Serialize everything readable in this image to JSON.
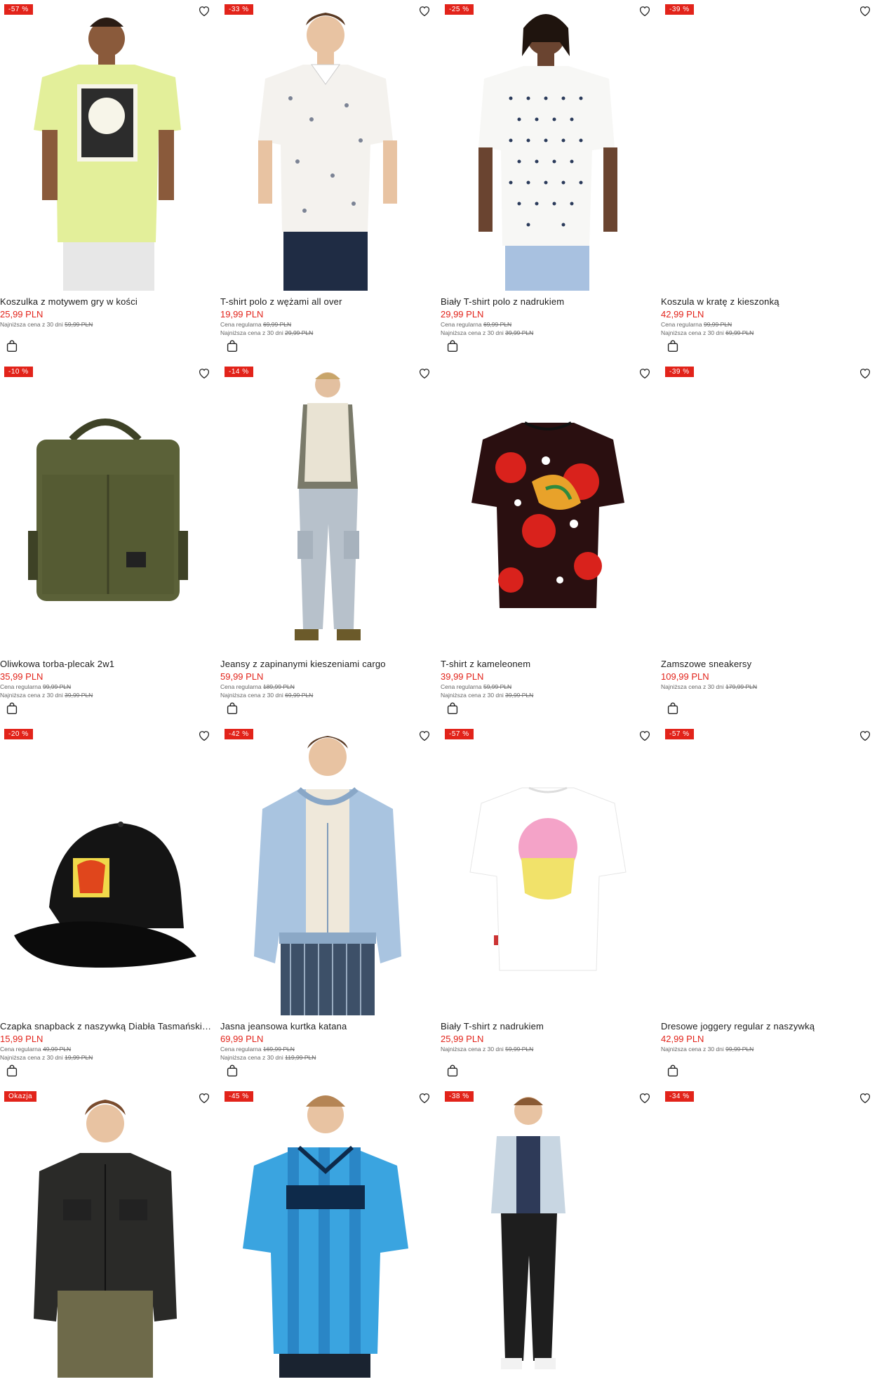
{
  "products": [
    {
      "name": "Koszulka z motywem gry w kości",
      "price": "25,99 PLN",
      "badge": "-57 %",
      "regular_label": "",
      "regular_price": "",
      "lowest_label": "Najniższa cena z 30 dni",
      "lowest_price": "59,99 PLN",
      "image": "yellow-tshirt-photo",
      "colors": {
        "main": "#e3ef9a",
        "accent": "#2c2c2c"
      }
    },
    {
      "name": "T-shirt polo z wężami all over",
      "price": "19,99 PLN",
      "badge": "-33 %",
      "regular_label": "Cena regularna",
      "regular_price": "69,99 PLN",
      "lowest_label": "Najniższa cena z 30 dni",
      "lowest_price": "29,99 PLN",
      "image": "white-polo-snakes-photo",
      "colors": {
        "main": "#f4f2ee",
        "accent": "#2b3a5a"
      }
    },
    {
      "name": "Biały T-shirt polo z nadrukiem",
      "price": "29,99 PLN",
      "badge": "-25 %",
      "regular_label": "Cena regularna",
      "regular_price": "69,99 PLN",
      "lowest_label": "Najniższa cena z 30 dni",
      "lowest_price": "39,99 PLN",
      "image": "white-polo-dots-photo",
      "colors": {
        "main": "#f7f7f5",
        "accent": "#a8c1e0"
      }
    },
    {
      "name": "Koszula w kratę z kieszonką",
      "price": "42,99 PLN",
      "badge": "-39 %",
      "regular_label": "Cena regularna",
      "regular_price": "99,99 PLN",
      "lowest_label": "Najniższa cena z 30 dni",
      "lowest_price": "69,99 PLN",
      "image": "",
      "colors": {
        "main": "#ffffff",
        "accent": "#ffffff"
      }
    },
    {
      "name": "Oliwkowa torba-plecak 2w1",
      "price": "35,99 PLN",
      "badge": "-10 %",
      "regular_label": "Cena regularna",
      "regular_price": "99,99 PLN",
      "lowest_label": "Najniższa cena z 30 dni",
      "lowest_price": "39,99 PLN",
      "image": "olive-backpack-photo",
      "colors": {
        "main": "#5b6138",
        "accent": "#3e4226"
      }
    },
    {
      "name": "Jeansy z zapinanymi kieszeniami cargo",
      "price": "59,99 PLN",
      "badge": "-14 %",
      "regular_label": "Cena regularna",
      "regular_price": "189,99 PLN",
      "lowest_label": "Najniższa cena z 30 dni",
      "lowest_price": "69,99 PLN",
      "image": "cargo-jeans-photo",
      "colors": {
        "main": "#b7c1cb",
        "accent": "#e9e3d3"
      }
    },
    {
      "name": "T-shirt z kameleonem",
      "price": "39,99 PLN",
      "badge": "",
      "regular_label": "Cena regularna",
      "regular_price": "59,99 PLN",
      "lowest_label": "Najniższa cena z 30 dni",
      "lowest_price": "39,99 PLN",
      "image": "chameleon-tshirt-photo",
      "colors": {
        "main": "#2a0f10",
        "accent": "#d9221c"
      }
    },
    {
      "name": "Zamszowe sneakersy",
      "price": "109,99 PLN",
      "badge": "-39 %",
      "regular_label": "",
      "regular_price": "",
      "lowest_label": "Najniższa cena z 30 dni",
      "lowest_price": "179,99 PLN",
      "image": "",
      "colors": {
        "main": "#ffffff",
        "accent": "#ffffff"
      }
    },
    {
      "name": "Czapka snapback z naszywką Diabła Tasmańskiego",
      "price": "15,99 PLN",
      "badge": "-20 %",
      "regular_label": "Cena regularna",
      "regular_price": "49,99 PLN",
      "lowest_label": "Najniższa cena z 30 dni",
      "lowest_price": "19,99 PLN",
      "image": "black-snapback-photo",
      "colors": {
        "main": "#141414",
        "accent": "#e0461c"
      }
    },
    {
      "name": "Jasna jeansowa kurtka katana",
      "price": "69,99 PLN",
      "badge": "-42 %",
      "regular_label": "Cena regularna",
      "regular_price": "169,99 PLN",
      "lowest_label": "Najniższa cena z 30 dni",
      "lowest_price": "119,99 PLN",
      "image": "denim-jacket-photo",
      "colors": {
        "main": "#a9c4e0",
        "accent": "#3d5068"
      }
    },
    {
      "name": "Biały T-shirt z nadrukiem",
      "price": "25,99 PLN",
      "badge": "-57 %",
      "regular_label": "",
      "regular_price": "",
      "lowest_label": "Najniższa cena z 30 dni",
      "lowest_price": "59,99 PLN",
      "image": "white-skull-tshirt-photo",
      "colors": {
        "main": "#ffffff",
        "accent": "#f4a3c8"
      }
    },
    {
      "name": "Dresowe joggery regular z naszywką",
      "price": "42,99 PLN",
      "badge": "-57 %",
      "regular_label": "",
      "regular_price": "",
      "lowest_label": "Najniższa cena z 30 dni",
      "lowest_price": "99,99 PLN",
      "image": "",
      "colors": {
        "main": "#ffffff",
        "accent": "#ffffff"
      }
    },
    {
      "name": "",
      "price": "",
      "badge": "Okazja",
      "regular_label": "",
      "regular_price": "",
      "lowest_label": "",
      "lowest_price": "",
      "image": "black-utility-shirt-photo",
      "colors": {
        "main": "#2a2a28",
        "accent": "#6e6a4a"
      }
    },
    {
      "name": "",
      "price": "",
      "badge": "-45 %",
      "regular_label": "",
      "regular_price": "",
      "lowest_label": "",
      "lowest_price": "",
      "image": "blue-jersey-photo",
      "colors": {
        "main": "#3aa4e0",
        "accent": "#0e2a4a"
      }
    },
    {
      "name": "",
      "price": "",
      "badge": "-38 %",
      "regular_label": "",
      "regular_price": "",
      "lowest_label": "",
      "lowest_price": "",
      "image": "light-denim-outfit-photo",
      "colors": {
        "main": "#c8d6e2",
        "accent": "#1e1e1e"
      }
    },
    {
      "name": "",
      "price": "",
      "badge": "-34 %",
      "regular_label": "",
      "regular_price": "",
      "lowest_label": "",
      "lowest_price": "",
      "image": "",
      "colors": {
        "main": "#ffffff",
        "accent": "#ffffff"
      }
    }
  ]
}
